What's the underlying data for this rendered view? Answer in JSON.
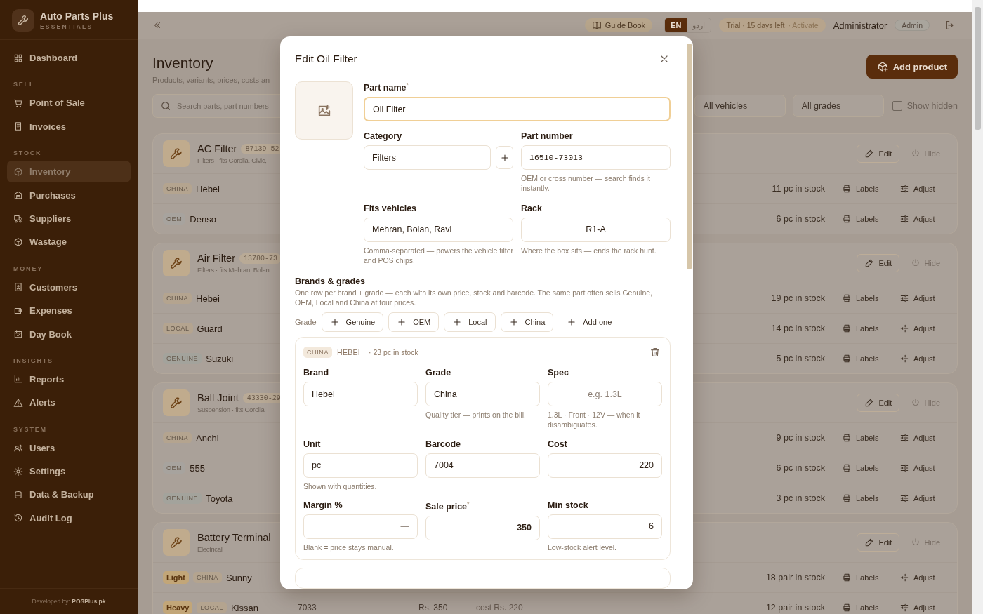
{
  "sidebar": {
    "brand": {
      "name": "Auto Parts Plus",
      "tagline": "ESSENTIALS"
    },
    "sections": [
      {
        "items": [
          {
            "label": "Dashboard",
            "selected": false
          }
        ]
      },
      {
        "label": "SELL",
        "items": [
          {
            "label": "Point of Sale",
            "selected": false
          },
          {
            "label": "Invoices",
            "selected": false
          }
        ]
      },
      {
        "label": "STOCK",
        "items": [
          {
            "label": "Inventory",
            "selected": true
          },
          {
            "label": "Purchases",
            "selected": false
          },
          {
            "label": "Suppliers",
            "selected": false
          },
          {
            "label": "Wastage",
            "selected": false
          }
        ]
      },
      {
        "label": "MONEY",
        "items": [
          {
            "label": "Customers",
            "selected": false
          },
          {
            "label": "Expenses",
            "selected": false
          },
          {
            "label": "Day Book",
            "selected": false
          }
        ]
      },
      {
        "label": "INSIGHTS",
        "items": [
          {
            "label": "Reports",
            "selected": false
          },
          {
            "label": "Alerts",
            "selected": false
          }
        ]
      },
      {
        "label": "SYSTEM",
        "items": [
          {
            "label": "Users",
            "selected": false
          },
          {
            "label": "Settings",
            "selected": false
          },
          {
            "label": "Data & Backup",
            "selected": false
          },
          {
            "label": "Audit Log",
            "selected": false
          }
        ]
      }
    ],
    "footer": "Developed by: **POSPlus.pk**"
  },
  "topbar": {
    "guide": "Guide Book",
    "languages": [
      {
        "label": "EN",
        "selected": true
      },
      {
        "label": "اردو",
        "selected": false
      }
    ],
    "trial": {
      "text": "Trial · 15 days left",
      "action": "· Activate"
    },
    "user": "Administrator",
    "role": "Admin"
  },
  "page": {
    "title": "Inventory",
    "subtitle": "Products, variants, prices, costs an",
    "add_button": "Add product",
    "search": {
      "placeholder": "Search parts, part numbers"
    },
    "filters": [
      {
        "value": "All vehicles"
      },
      {
        "value": "All grades"
      }
    ],
    "show_hidden": {
      "label": "Show hidden",
      "checked": false
    }
  },
  "products": [
    {
      "name": "AC Filter",
      "part_number": "87139-52",
      "subtitle": "Filters · fits Corolla, Civic,",
      "edit": "Edit",
      "hide": "Hide",
      "variants": [
        {
          "tags": [
            {
              "label": "CHINA",
              "kind": "grade",
              "color": "#b4a48f"
            }
          ],
          "brand": "Hebei",
          "stock": "11 pc in stock",
          "labels": "Labels",
          "adjust": "Adjust"
        },
        {
          "tags": [
            {
              "label": "OEM",
              "kind": "grade",
              "color": "#a7a39e"
            }
          ],
          "brand": "Denso",
          "stock": "6 pc in stock",
          "labels": "Labels",
          "adjust": "Adjust"
        }
      ]
    },
    {
      "name": "Air Filter",
      "part_number": "13780-73",
      "subtitle": "Filters · fits Mehran, Bolan",
      "edit": "Edit",
      "hide": "Hide",
      "variants": [
        {
          "tags": [
            {
              "label": "CHINA",
              "kind": "grade",
              "color": "#b4a48f"
            }
          ],
          "brand": "Hebei",
          "stock": "19 pc in stock",
          "labels": "Labels",
          "adjust": "Adjust"
        },
        {
          "tags": [
            {
              "label": "LOCAL",
              "kind": "grade",
              "color": "#b4a48f"
            }
          ],
          "brand": "Guard",
          "stock": "14 pc in stock",
          "labels": "Labels",
          "adjust": "Adjust"
        },
        {
          "tags": [
            {
              "label": "GENUINE",
              "kind": "grade",
              "color": "#a3a39c"
            }
          ],
          "brand": "Suzuki",
          "stock": "5 pc in stock",
          "labels": "Labels",
          "adjust": "Adjust"
        }
      ]
    },
    {
      "name": "Ball Joint",
      "part_number": "43330-29",
      "subtitle": "Suspension · fits Corolla",
      "edit": "Edit",
      "hide": "Hide",
      "variants": [
        {
          "tags": [
            {
              "label": "CHINA",
              "kind": "grade",
              "color": "#b4a48f"
            }
          ],
          "brand": "Anchi",
          "stock": "9 pc in stock",
          "labels": "Labels",
          "adjust": "Adjust"
        },
        {
          "tags": [
            {
              "label": "OEM",
              "kind": "grade",
              "color": "#a7a39e"
            }
          ],
          "brand": "555",
          "stock": "6 pc in stock",
          "labels": "Labels",
          "adjust": "Adjust"
        },
        {
          "tags": [
            {
              "label": "GENUINE",
              "kind": "grade",
              "color": "#a3a39c"
            }
          ],
          "brand": "Toyota",
          "stock": "3 pc in stock",
          "labels": "Labels",
          "adjust": "Adjust"
        }
      ]
    },
    {
      "name": "Battery Terminal",
      "subtitle": "Electrical",
      "edit": "Edit",
      "hide": "Hide",
      "variants": [
        {
          "tags": [
            {
              "label": "Light",
              "kind": "size",
              "color": "#c2a678"
            },
            {
              "label": "CHINA",
              "kind": "grade",
              "color": "#b4a48f"
            }
          ],
          "brand": "Sunny",
          "stock": "18 pair in stock",
          "labels": "Labels",
          "adjust": "Adjust"
        },
        {
          "tags": [
            {
              "label": "Heavy",
              "kind": "size",
              "color": "#c2a678"
            },
            {
              "label": "LOCAL",
              "kind": "grade",
              "color": "#b4a48f"
            }
          ],
          "brand": "Kissan",
          "part": "7033",
          "price": "Rs. 350",
          "cost": "cost Rs. 220",
          "stock": "12 pair in stock",
          "labels": "Labels",
          "adjust": "Adjust"
        }
      ]
    }
  ],
  "modal": {
    "title": "Edit Oil Filter",
    "part_name": {
      "label": "Part name$^{*}$",
      "value": "Oil Filter",
      "focused": true
    },
    "category": {
      "label": "Category",
      "value": "Filters"
    },
    "part_number": {
      "label": "Part number",
      "value": "16510-73013",
      "help": "OEM or cross number — search finds it instantly."
    },
    "vehicles": {
      "label": "Fits vehicles",
      "value": "Mehran, Bolan, Ravi",
      "help": "Comma-separated — powers the vehicle filter and POS chips."
    },
    "rack": {
      "label": "Rack",
      "value": "R1-A",
      "help": "Where the box sits — ends the rack hunt."
    },
    "brands": {
      "title": "Brands & grades",
      "description": "One row per brand + grade — each with its own price, stock and barcode. The same part often sells Genuine, OEM, Local and China at four prices.",
      "grade_label": "Grade",
      "grade_buttons": [
        "Genuine",
        "OEM",
        "Local",
        "China"
      ],
      "add_button": "Add one"
    },
    "brand_rows": [
      {
        "grade": "CHINA",
        "brand": "HEBEI",
        "stock": "· 23 pc in stock",
        "fields": [
          {
            "label": "Brand",
            "value": "Hebei",
            "kind": "text"
          },
          {
            "label": "Grade",
            "value": "China",
            "kind": "text",
            "help": "Quality tier — prints on the bill."
          },
          {
            "label": "Spec",
            "placeholder": "e.g. 1.3L",
            "kind": "centered",
            "help": "1.3L · Front · 12V — when it disambiguates."
          },
          {
            "label": "Unit",
            "value": "pc",
            "kind": "text",
            "help": "Shown with quantities."
          },
          {
            "label": "Barcode",
            "value": "7004",
            "kind": "text"
          },
          {
            "label": "Cost",
            "value": "220",
            "kind": "number"
          },
          {
            "label": "Margin %",
            "placeholder": "—",
            "kind": "number",
            "help": "Blank = price stays manual."
          },
          {
            "label": "Sale price$^{*}$",
            "value": "350",
            "kind": "number",
            "strong": true
          },
          {
            "label": "Min stock",
            "value": "6",
            "kind": "number",
            "help": "Low-stock alert level."
          }
        ]
      }
    ]
  }
}
